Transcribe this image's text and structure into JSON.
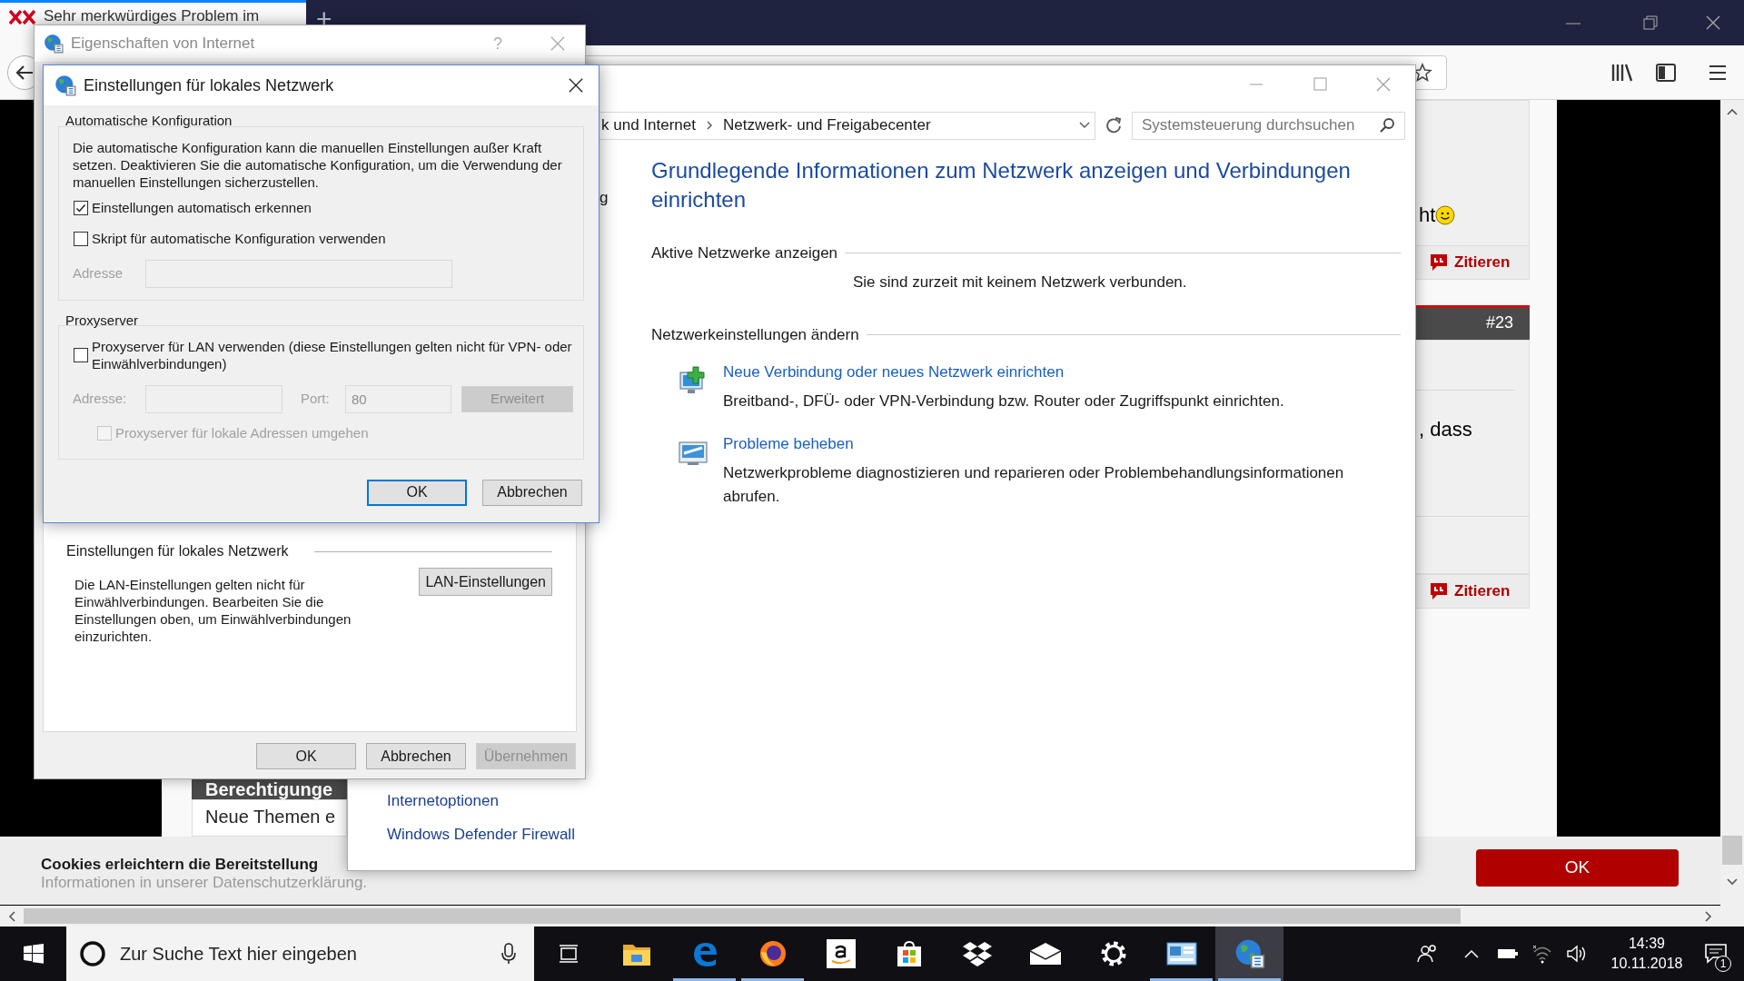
{
  "browser": {
    "tab": {
      "title": "Sehr merkwürdiges Problem im"
    },
    "new_tab": "+"
  },
  "forum": {
    "post_text_1": "ht",
    "quote_buttons": [
      "Zitieren",
      "Zitieren"
    ],
    "post_number": "#23",
    "post_text_2": ", dass",
    "section_header": "Berechtigunge",
    "section_text": "Neue Themen e"
  },
  "cookie_banner": {
    "text": "Cookies erleichtern die Bereitstellung",
    "text_2": "Informationen in unserer Datenschutzerklärung.",
    "button": "OK"
  },
  "control_panel": {
    "breadcrumb": [
      "k und Internet",
      "Netzwerk- und Freigabecenter"
    ],
    "search_placeholder": "Systemsteuerung durchsuchen",
    "nav_fragment": "g",
    "heading": "Grundlegende Informationen zum Netzwerk anzeigen und Verbindungen einrichten",
    "active_networks_label": "Aktive Netzwerke anzeigen",
    "active_networks_status": "Sie sind zurzeit mit keinem Netzwerk verbunden.",
    "settings_label": "Netzwerkeinstellungen ändern",
    "tasks": [
      {
        "kind": "new-connection",
        "link": "Neue Verbindung oder neues Netzwerk einrichten",
        "description": "Breitband-, DFÜ- oder VPN-Verbindung bzw. Router oder Zugriffspunkt einrichten."
      },
      {
        "kind": "troubleshoot",
        "link": "Probleme beheben",
        "description": "Netzwerkprobleme diagnostizieren und reparieren oder Problembehandlungsinformationen abrufen."
      }
    ],
    "see_also": [
      "Internetoptionen",
      "Windows Defender Firewall"
    ]
  },
  "internet_properties": {
    "title": "Eigenschaften von Internet",
    "help": "?",
    "lan_group": {
      "label": "Einstellungen für lokales Netzwerk",
      "description": "Die LAN-Einstellungen gelten nicht für Einwählverbindungen. Bearbeiten Sie die Einstellungen oben, um Einwählverbindungen einzurichten.",
      "button": "LAN-Einstellungen"
    },
    "buttons": [
      {
        "label": "OK",
        "disabled": false
      },
      {
        "label": "Abbrechen",
        "disabled": false
      },
      {
        "label": "Übernehmen",
        "disabled": true
      }
    ]
  },
  "lan_dialog": {
    "title": "Einstellungen für lokales Netzwerk",
    "auto_config": {
      "label": "Automatische Konfiguration",
      "description": "Die automatische Konfiguration kann die manuellen Einstellungen außer Kraft setzen. Deaktivieren Sie die automatische Konfiguration, um die Verwendung der manuellen Einstellungen sicherzustellen.",
      "options": [
        {
          "label": "Einstellungen automatisch erkennen",
          "checked": true
        },
        {
          "label": "Skript für automatische Konfiguration verwenden",
          "checked": false
        }
      ],
      "address_label": "Adresse",
      "address_disabled": true
    },
    "proxy": {
      "label": "Proxyserver",
      "option": {
        "label": "Proxyserver für LAN verwenden (diese Einstellungen gelten nicht für VPN- oder Einwählverbindungen)",
        "checked": false
      },
      "address_label": "Adresse:",
      "port_label": "Port:",
      "port_value": "80",
      "advanced_button": "Erweitert",
      "fields_disabled": true,
      "bypass": {
        "label": "Proxyserver für lokale Adressen umgehen",
        "checked": false,
        "disabled": true
      }
    },
    "buttons": [
      {
        "label": "OK",
        "default": true
      },
      {
        "label": "Abbrechen",
        "default": false
      }
    ]
  },
  "taskbar": {
    "search_placeholder": "Zur Suche Text hier eingeben",
    "apps": [
      {
        "kind": "task-view",
        "running": false,
        "selected": false
      },
      {
        "kind": "explorer",
        "running": false,
        "selected": false
      },
      {
        "kind": "edge",
        "running": true,
        "selected": false
      },
      {
        "kind": "firefox",
        "running": true,
        "selected": false
      },
      {
        "kind": "amazon",
        "running": false,
        "selected": false
      },
      {
        "kind": "store",
        "running": false,
        "selected": false
      },
      {
        "kind": "dropbox",
        "running": false,
        "selected": false
      },
      {
        "kind": "mail",
        "running": false,
        "selected": false
      },
      {
        "kind": "settings",
        "running": false,
        "selected": false
      },
      {
        "kind": "control-panel",
        "running": true,
        "selected": false
      },
      {
        "kind": "internet-options",
        "running": true,
        "selected": true
      }
    ],
    "clock": {
      "time": "14:39",
      "date": "10.11.2018"
    },
    "notification_count": "1"
  }
}
